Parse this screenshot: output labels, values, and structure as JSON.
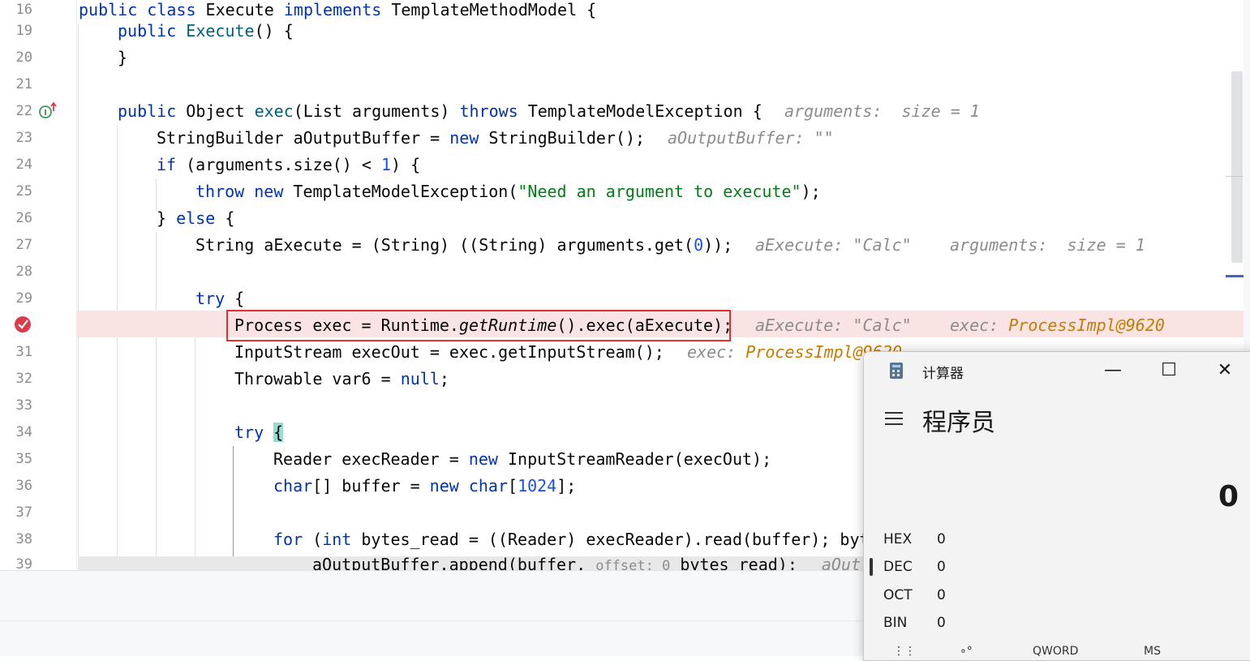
{
  "editor": {
    "lines": [
      {
        "n": "16",
        "top": 0
      },
      {
        "n": "19"
      },
      {
        "n": "20"
      },
      {
        "n": "21"
      },
      {
        "n": "22"
      },
      {
        "n": "23"
      },
      {
        "n": "24"
      },
      {
        "n": "25"
      },
      {
        "n": "26"
      },
      {
        "n": "27"
      },
      {
        "n": "28"
      },
      {
        "n": "29"
      },
      {
        "n": "30"
      },
      {
        "n": "31"
      },
      {
        "n": "32"
      },
      {
        "n": "33"
      },
      {
        "n": "34"
      },
      {
        "n": "35"
      },
      {
        "n": "36"
      },
      {
        "n": "37"
      },
      {
        "n": "38"
      },
      {
        "n": "39"
      }
    ],
    "code": {
      "l16": {
        "a": "public class ",
        "b": "Execute ",
        "c": "implements ",
        "d": "TemplateMethodModel {"
      },
      "l19": {
        "a": "public ",
        "b": "Execute",
        "c": "() {"
      },
      "l20": "}",
      "l22": {
        "a": "public ",
        "b": "Object ",
        "c": "exec",
        "d": "(List arguments) ",
        "e": "throws ",
        "f": "TemplateModelException {",
        "h1": "arguments:  size = 1"
      },
      "l23": {
        "a": "StringBuilder aOutputBuffer = ",
        "b": "new ",
        "c": "StringBuilder();",
        "h1": "aOutputBuffer: \"\""
      },
      "l24": {
        "a": "if ",
        "b": "(arguments.size() < ",
        "c": "1",
        "d": ") {"
      },
      "l25": {
        "a": "throw ",
        "b": "new ",
        "c": "TemplateModelException(",
        "d": "\"Need an argument to execute\"",
        "e": ");"
      },
      "l26": {
        "a": "} ",
        "b": "else ",
        "c": "{"
      },
      "l27": {
        "a": "String aExecute = (String) ((String) arguments.get(",
        "b": "0",
        "c": "));",
        "h1": "aExecute: \"Calc\"",
        "h2": "arguments:  size = 1"
      },
      "l29": {
        "a": "try ",
        "b": "{"
      },
      "l30": {
        "a": "Process exec = Runtime.",
        "b": "getRuntime",
        "c": "().exec(aExecute);",
        "h1": "aExecute: \"Calc\"",
        "h2": "exec: ",
        "h3": "ProcessImpl@9620"
      },
      "l31": {
        "a": "InputStream execOut = exec.getInputStream();",
        "h1": "exec: ",
        "h2": "ProcessImpl@9620"
      },
      "l32": {
        "a": "Throwable var6 = ",
        "b": "null",
        "c": ";"
      },
      "l34": {
        "a": "try ",
        "b": "{"
      },
      "l35": {
        "a": "Reader execReader = ",
        "b": "new ",
        "c": "InputStreamReader(execOut);"
      },
      "l36": {
        "a": "char",
        "b": "[] buffer = ",
        "c": "new ",
        "d": "char",
        "e": "[",
        "f": "1024",
        "g": "];"
      },
      "l38": {
        "a": "for ",
        "b": "(",
        "c": "int ",
        "d": "bytes_read = ((Reader) execReader).read(buffer); byt"
      },
      "l39": {
        "a": "aOutputBuffer.append(buffer, ",
        "h1": "offset: 0",
        "b": " bytes_read);",
        "h2": "aOut"
      }
    }
  },
  "calculator": {
    "title": "计算器",
    "minimize": "—",
    "maximize": "☐",
    "close": "✕",
    "mode": "程序员",
    "display": "0",
    "radix": [
      {
        "label": "HEX",
        "value": "0"
      },
      {
        "label": "DEC",
        "value": "0"
      },
      {
        "label": "OCT",
        "value": "0"
      },
      {
        "label": "BIN",
        "value": "0"
      }
    ],
    "bottom": [
      "QWORD",
      "MS"
    ]
  },
  "colors": {
    "keyword": "#0033b3",
    "string": "#067d17",
    "hint_value": "#c77b00",
    "breakpoint": "#db3b4b",
    "highlight": "#fae3e3"
  }
}
